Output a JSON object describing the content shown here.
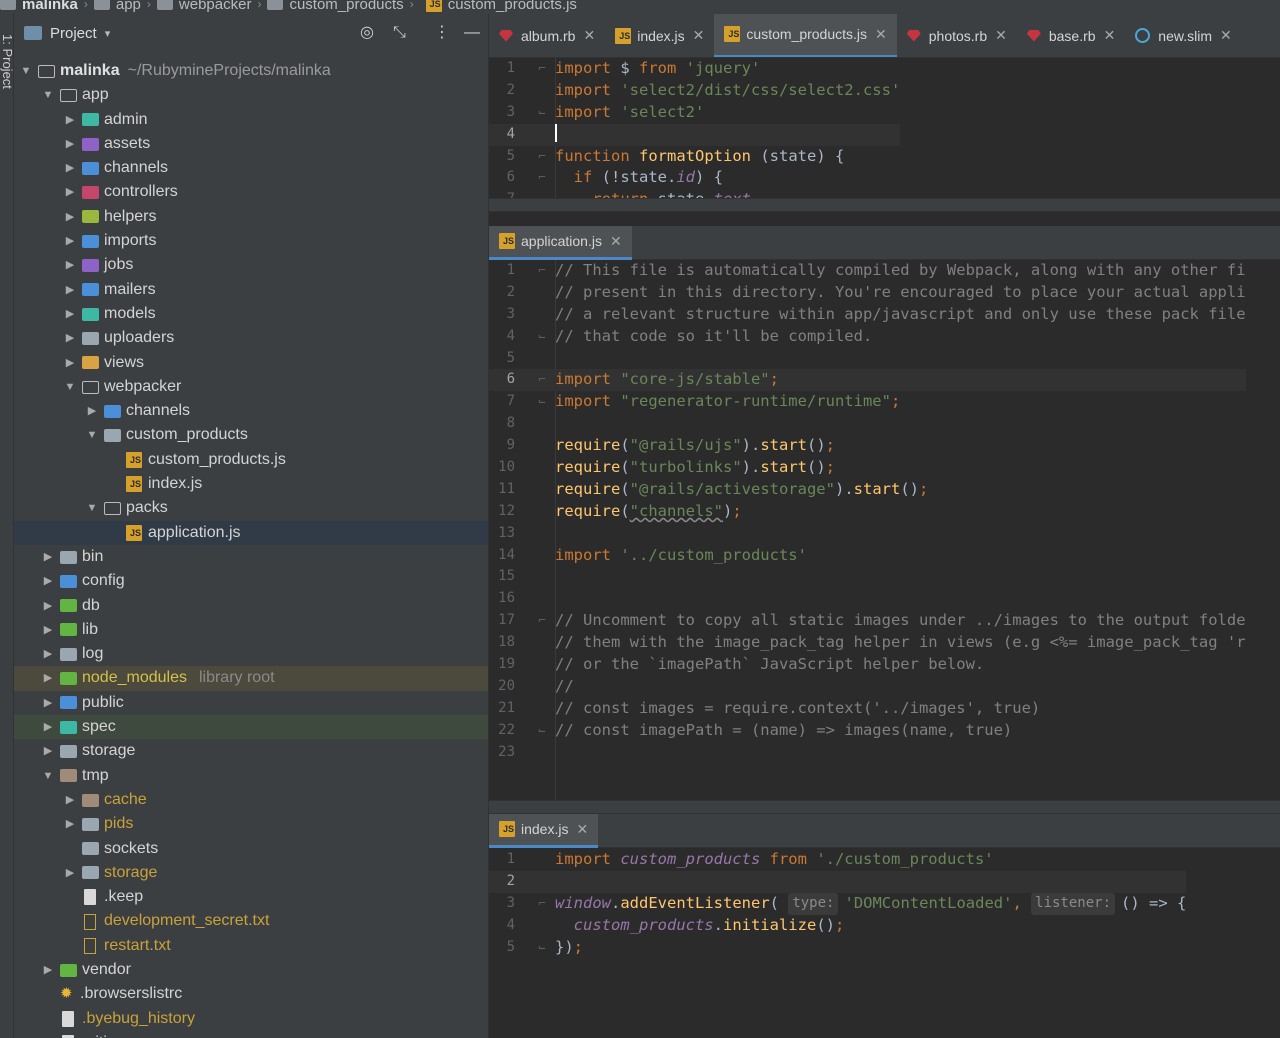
{
  "breadcrumb": [
    "malinka",
    "app",
    "webpacker",
    "custom_products",
    "custom_products.js"
  ],
  "side_strip": {
    "label": "1: Project"
  },
  "project_panel": {
    "title": "Project",
    "root_name": "malinka",
    "root_path": "~/RubymineProjects/malinka",
    "library_root_label": "library root",
    "tree": [
      {
        "label": "app",
        "depth": 1,
        "arrow": "open",
        "icon": "outline"
      },
      {
        "label": "admin",
        "depth": 2,
        "arrow": "closed",
        "icon": "teal"
      },
      {
        "label": "assets",
        "depth": 2,
        "arrow": "closed",
        "icon": "purple"
      },
      {
        "label": "channels",
        "depth": 2,
        "arrow": "closed",
        "icon": "blue"
      },
      {
        "label": "controllers",
        "depth": 2,
        "arrow": "closed",
        "icon": "pink"
      },
      {
        "label": "helpers",
        "depth": 2,
        "arrow": "closed",
        "icon": "lime"
      },
      {
        "label": "imports",
        "depth": 2,
        "arrow": "closed",
        "icon": "blue"
      },
      {
        "label": "jobs",
        "depth": 2,
        "arrow": "closed",
        "icon": "purple"
      },
      {
        "label": "mailers",
        "depth": 2,
        "arrow": "closed",
        "icon": "blue"
      },
      {
        "label": "models",
        "depth": 2,
        "arrow": "closed",
        "icon": "teal"
      },
      {
        "label": "uploaders",
        "depth": 2,
        "arrow": "closed",
        "icon": "plain"
      },
      {
        "label": "views",
        "depth": 2,
        "arrow": "closed",
        "icon": "orange"
      },
      {
        "label": "webpacker",
        "depth": 2,
        "arrow": "open",
        "icon": "outline"
      },
      {
        "label": "channels",
        "depth": 3,
        "arrow": "closed",
        "icon": "blue"
      },
      {
        "label": "custom_products",
        "depth": 3,
        "arrow": "open",
        "icon": "plain"
      },
      {
        "label": "custom_products.js",
        "depth": 4,
        "arrow": "none",
        "icon": "js"
      },
      {
        "label": "index.js",
        "depth": 4,
        "arrow": "none",
        "icon": "js"
      },
      {
        "label": "packs",
        "depth": 3,
        "arrow": "open",
        "icon": "outline"
      },
      {
        "label": "application.js",
        "depth": 4,
        "arrow": "none",
        "icon": "js",
        "state": "sel"
      },
      {
        "label": "bin",
        "depth": 1,
        "arrow": "closed",
        "icon": "plain"
      },
      {
        "label": "config",
        "depth": 1,
        "arrow": "closed",
        "icon": "blue"
      },
      {
        "label": "db",
        "depth": 1,
        "arrow": "closed",
        "icon": "green"
      },
      {
        "label": "lib",
        "depth": 1,
        "arrow": "closed",
        "icon": "green"
      },
      {
        "label": "log",
        "depth": 1,
        "arrow": "closed",
        "icon": "plain"
      },
      {
        "label": "node_modules",
        "depth": 1,
        "arrow": "closed",
        "icon": "green",
        "state": "hl-yellow",
        "color": "muted",
        "lib": true
      },
      {
        "label": "public",
        "depth": 1,
        "arrow": "closed",
        "icon": "blue"
      },
      {
        "label": "spec",
        "depth": 1,
        "arrow": "closed",
        "icon": "teal",
        "state": "hl-green"
      },
      {
        "label": "storage",
        "depth": 1,
        "arrow": "closed",
        "icon": "plain"
      },
      {
        "label": "tmp",
        "depth": 1,
        "arrow": "open",
        "icon": "brown"
      },
      {
        "label": "cache",
        "depth": 2,
        "arrow": "closed",
        "icon": "brown",
        "color": "excluded"
      },
      {
        "label": "pids",
        "depth": 2,
        "arrow": "closed",
        "icon": "plain",
        "color": "excluded"
      },
      {
        "label": "sockets",
        "depth": 2,
        "arrow": "none",
        "icon": "plain"
      },
      {
        "label": "storage",
        "depth": 2,
        "arrow": "closed",
        "icon": "plain",
        "color": "excluded"
      },
      {
        "label": ".keep",
        "depth": 2,
        "arrow": "none",
        "icon": "file"
      },
      {
        "label": "development_secret.txt",
        "depth": 2,
        "arrow": "none",
        "icon": "txt",
        "color": "excluded"
      },
      {
        "label": "restart.txt",
        "depth": 2,
        "arrow": "none",
        "icon": "txt",
        "color": "excluded"
      },
      {
        "label": "vendor",
        "depth": 1,
        "arrow": "closed",
        "icon": "green"
      },
      {
        "label": ".browserslistrc",
        "depth": 1,
        "arrow": "none",
        "icon": "star"
      },
      {
        "label": ".byebug_history",
        "depth": 1,
        "arrow": "none",
        "icon": "file",
        "color": "excluded"
      },
      {
        "label": ".gitignore",
        "depth": 1,
        "arrow": "none",
        "icon": "file"
      }
    ]
  },
  "top_tabs": [
    {
      "label": "album.rb",
      "icon": "ruby"
    },
    {
      "label": "index.js",
      "icon": "js"
    },
    {
      "label": "custom_products.js",
      "icon": "js",
      "active": true
    },
    {
      "label": "photos.rb",
      "icon": "ruby"
    },
    {
      "label": "base.rb",
      "icon": "ruby"
    },
    {
      "label": "new.slim",
      "icon": "slim"
    }
  ],
  "pane2_tab": "application.js",
  "pane3_tab": "index.js",
  "icons": {
    "close": "close-icon",
    "settings": "target-icon",
    "collapse": "collapse-icon",
    "more": "kebab-icon",
    "minimize": "minimize-icon"
  },
  "colors": {
    "keyword": "#cc7832",
    "string": "#6a8759",
    "comment": "#808080",
    "function": "#ffc66d",
    "accent": "#4a88c7"
  }
}
